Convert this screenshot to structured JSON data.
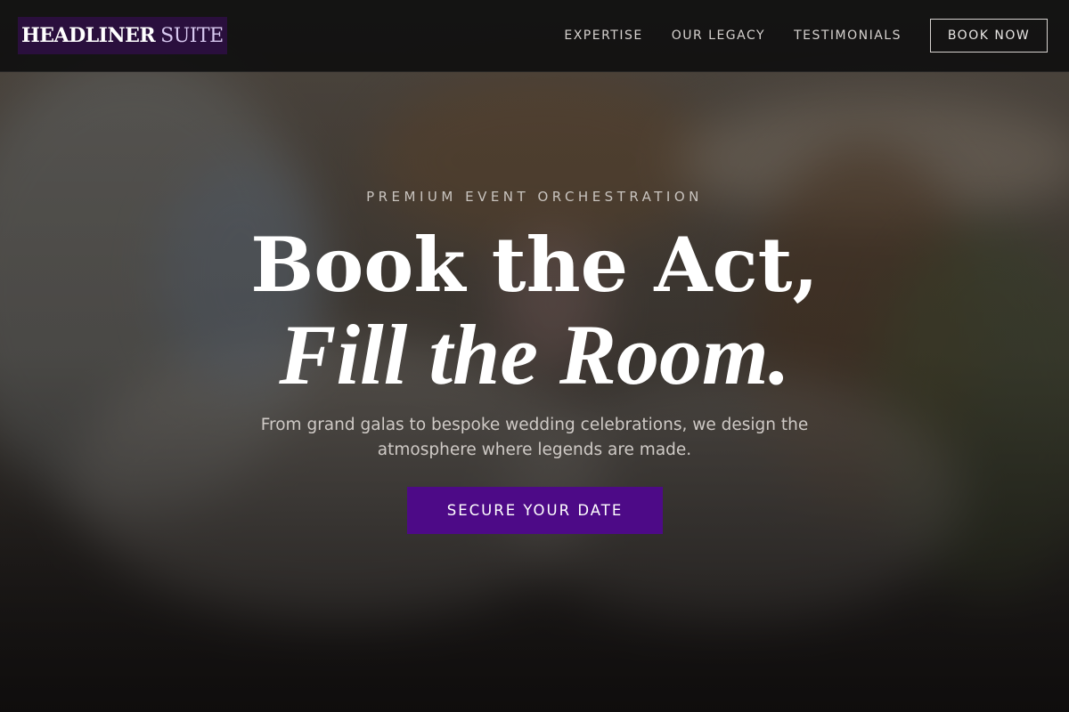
{
  "brand": {
    "name_part1": "HEADLINER",
    "name_part2": "SUITE"
  },
  "nav": {
    "links": [
      {
        "label": "EXPERTISE"
      },
      {
        "label": "OUR LEGACY"
      },
      {
        "label": "TESTIMONIALS"
      }
    ],
    "cta_label": "BOOK NOW"
  },
  "hero": {
    "eyebrow": "PREMIUM EVENT ORCHESTRATION",
    "headline_line1": "Book the Act,",
    "headline_line2": "Fill the Room.",
    "subtitle": "From grand galas to bespoke wedding celebrations, we design the atmosphere where legends are made.",
    "cta_label": "SECURE YOUR DATE"
  },
  "colors": {
    "accent": "#4d0a87",
    "logo_bg": "#2a0f3d",
    "navbar_bg": "#0e0e0e"
  }
}
